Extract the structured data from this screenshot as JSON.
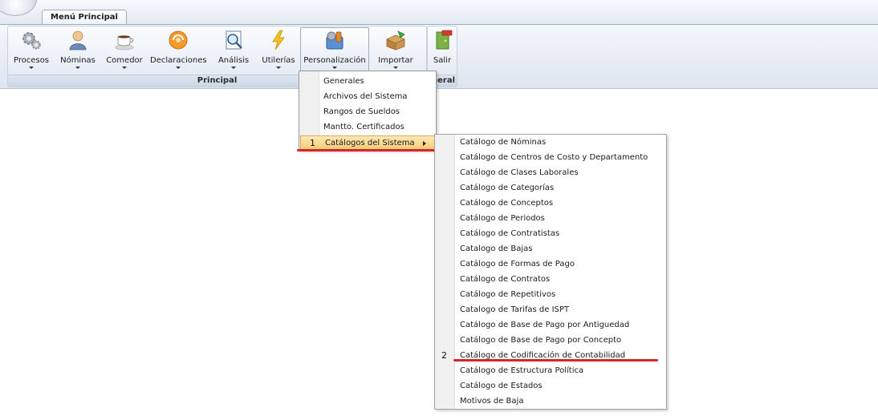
{
  "tab": {
    "label": "Menú Principal"
  },
  "ribbon": {
    "buttons": [
      {
        "label": "Procesos",
        "icon": "gears-icon"
      },
      {
        "label": "Nóminas",
        "icon": "user-icon"
      },
      {
        "label": "Comedor",
        "icon": "coffee-cup-icon"
      },
      {
        "label": "Declaraciones",
        "icon": "orange-disc-icon"
      },
      {
        "label": "Análisis",
        "icon": "magnifier-icon"
      },
      {
        "label": "Utilerías",
        "icon": "lightning-icon"
      },
      {
        "label": "Personalización",
        "icon": "tools-icon"
      },
      {
        "label": "Importar",
        "icon": "import-box-icon"
      },
      {
        "label": "Salir",
        "icon": "exit-door-icon"
      }
    ],
    "group_principal": "Principal",
    "group_general_visible": "neral"
  },
  "menu": {
    "items": [
      "Generales",
      "Archivos del Sistema",
      "Rangos de Sueldos",
      "Mantto. Certificados",
      "Catálogos del Sistema"
    ],
    "marker": "1"
  },
  "submenu": {
    "items": [
      "Catálogo de Nóminas",
      "Catálogo de Centros de Costo y Departamento",
      "Catálogo de Clases Laborales",
      "Catálogo de Categorías",
      "Catálogo de Conceptos",
      "Catálogo de Periodos",
      "Catálogo de Contratistas",
      "Catalogo de Bajas",
      "Catálogo de Formas de Pago",
      "Catálogo de Contratos",
      "Catálogo de Repetitivos",
      "Catalogo de Tarifas de ISPT",
      "Catálogo de Base de Pago por Antiguedad",
      "Catálogo de Base de Pago por Concepto",
      "Catálogo de Codificación de Contabilidad",
      "Catálogo de Estructura Política",
      "Catálogo de Estados",
      "Motivos de Baja"
    ],
    "marker": "2"
  },
  "colors": {
    "highlight": "#f8c970",
    "annotation_red": "#d7262b"
  }
}
